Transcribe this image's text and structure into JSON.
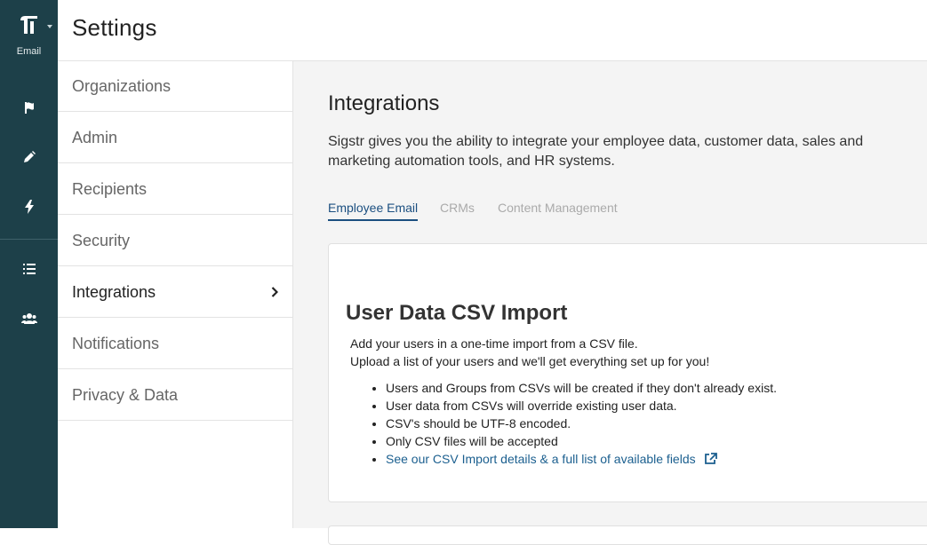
{
  "rail": {
    "logo_label": "Email",
    "icons": [
      "flag-icon",
      "pen-icon",
      "lightning-icon",
      "list-icon",
      "users-icon"
    ]
  },
  "header": {
    "title": "Settings"
  },
  "nav": {
    "items": [
      {
        "label": "Organizations"
      },
      {
        "label": "Admin"
      },
      {
        "label": "Recipients"
      },
      {
        "label": "Security"
      },
      {
        "label": "Integrations"
      },
      {
        "label": "Notifications"
      },
      {
        "label": "Privacy & Data"
      }
    ],
    "active": "Integrations"
  },
  "main": {
    "title": "Integrations",
    "intro": "Sigstr gives you the ability to integrate your employee data, customer data, sales and marketing automation tools, and HR systems.",
    "tabs": [
      {
        "label": "Employee Email"
      },
      {
        "label": "CRMs"
      },
      {
        "label": "Content Management"
      }
    ],
    "active_tab": "Employee Email",
    "card": {
      "title": "User Data CSV Import",
      "desc_line1": "Add your users in a one-time import from a CSV file.",
      "desc_line2": "Upload a list of your users and we'll get everything set up for you!",
      "bullets": [
        "Users and Groups from CSVs will be created if they don't already exist.",
        "User data from CSVs will override existing user data.",
        "CSV's should be UTF-8 encoded.",
        "Only CSV files will be accepted"
      ],
      "link": "See our CSV Import details & a full list of available fields"
    }
  },
  "colors": {
    "rail_bg": "#1d4049",
    "accent": "#1b4f80",
    "link": "#1b5f8f"
  }
}
